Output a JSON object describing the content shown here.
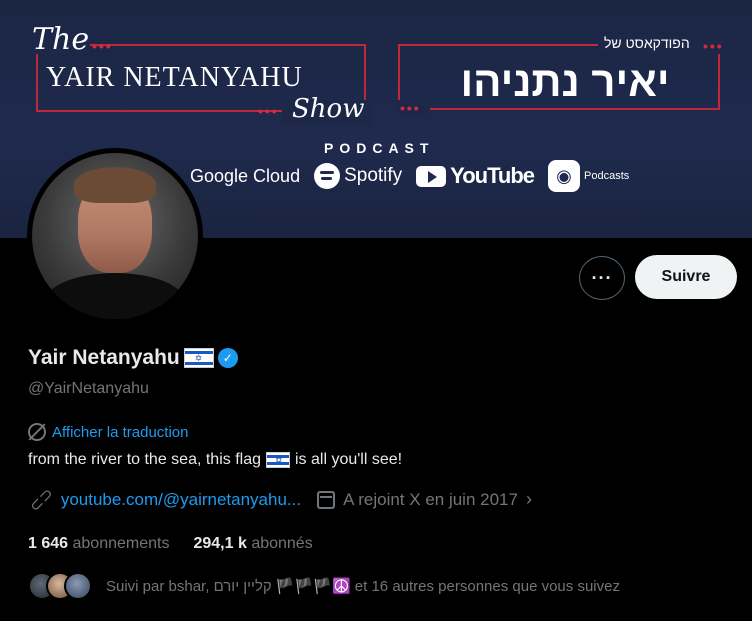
{
  "banner": {
    "the": "The",
    "show_name": "YAIR NETANYAHU",
    "show": "Show",
    "hebrew_small": "הפודקאסט של",
    "hebrew_big": "יאיר נתניהו",
    "podcast": "PODCAST",
    "platforms": {
      "google": "Google Cloud",
      "spotify": "Spotify",
      "youtube": "YouTube",
      "podcasts": "Podcasts"
    }
  },
  "actions": {
    "more": "···",
    "follow": "Suivre"
  },
  "profile": {
    "name": "Yair Netanyahu",
    "handle": "@YairNetanyahu",
    "translate": "Afficher la traduction",
    "bio_before": "from the river to the sea, this flag",
    "bio_after": "is all you'll see!",
    "link": "youtube.com/@yairnetanyahu...",
    "joined": "A rejoint X en juin 2017"
  },
  "stats": {
    "following_count": "1 646",
    "following_label": "abonnements",
    "followers_count": "294,1 k",
    "followers_label": "abonnés"
  },
  "followed_by": "Suivi par bshar, קליין יורם 🏴🏴🏴☮️ et 16 autres personnes que vous suivez",
  "colors": {
    "accent": "#1d9bf0",
    "banner_bg": "#1f2a4d",
    "banner_red": "#c0283a"
  },
  "icons": [
    "more-icon",
    "verified-icon",
    "translate-icon",
    "link-icon",
    "calendar-icon",
    "chevron-right-icon",
    "flag-icon"
  ]
}
